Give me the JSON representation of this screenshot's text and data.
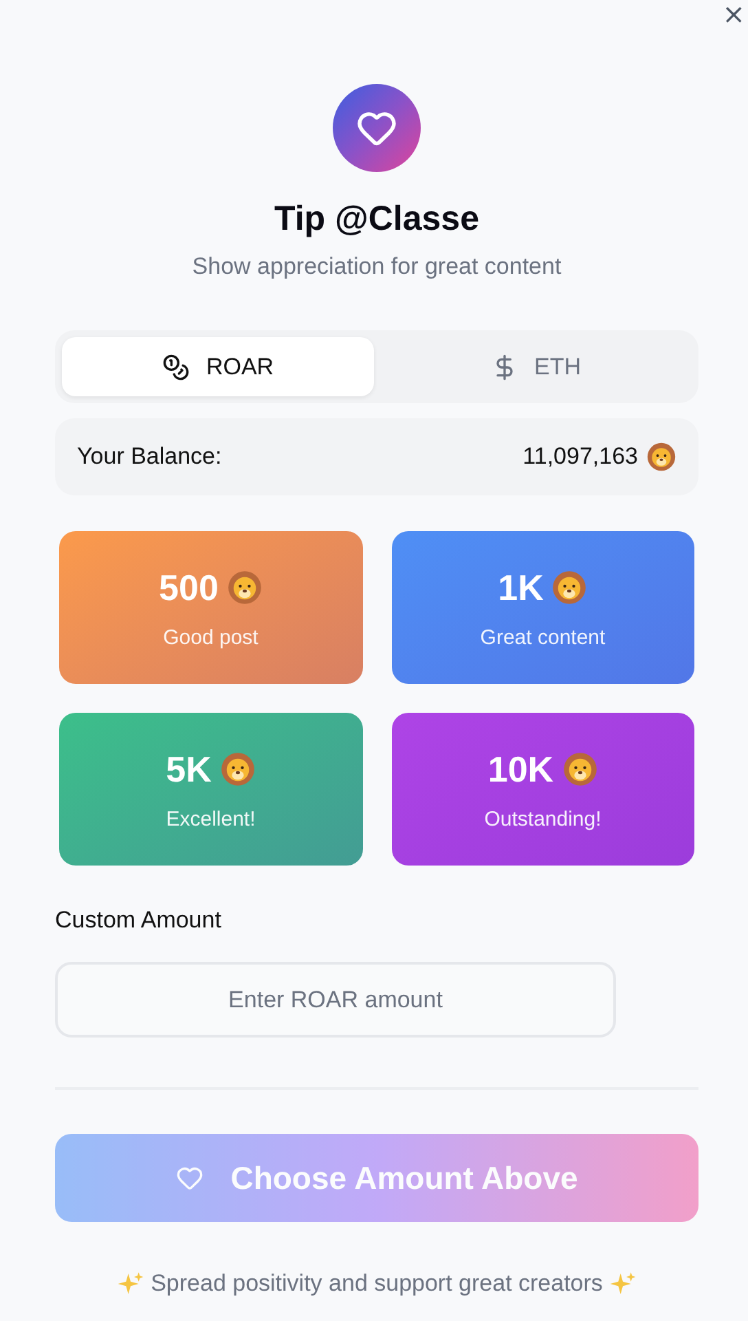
{
  "close": {
    "label": "×"
  },
  "header": {
    "title": "Tip @Classe",
    "subtitle": "Show appreciation for great content"
  },
  "tabs": [
    {
      "label": "ROAR",
      "kind": "coins",
      "selected": true
    },
    {
      "label": "ETH",
      "kind": "dollar",
      "selected": false
    }
  ],
  "balance": {
    "label": "Your Balance:",
    "value": "11,097,163"
  },
  "tiers": [
    {
      "amount": "500",
      "caption": "Good post",
      "color": "#fb9a4b"
    },
    {
      "amount": "1K",
      "caption": "Great content",
      "color": "#4f8ff5"
    },
    {
      "amount": "5K",
      "caption": "Excellent!",
      "color": "#3cbf8a"
    },
    {
      "amount": "10K",
      "caption": "Outstanding!",
      "color": "#ae44e6"
    }
  ],
  "custom": {
    "label": "Custom Amount",
    "placeholder": "Enter ROAR amount"
  },
  "submit": {
    "label": "Choose Amount Above",
    "disabled": true
  },
  "footer": {
    "text": "Spread positivity and support great creators"
  }
}
